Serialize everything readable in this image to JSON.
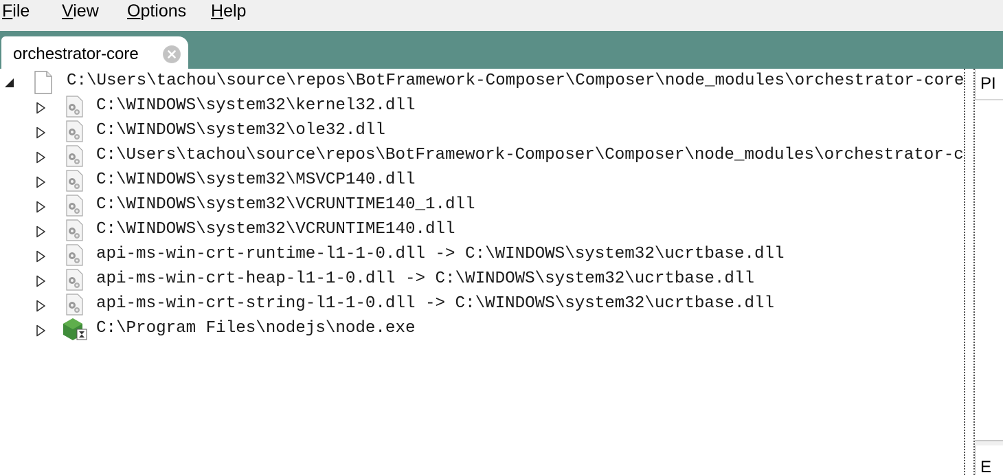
{
  "menu": {
    "items": [
      {
        "name": "file",
        "accel": "F",
        "rest": "ile"
      },
      {
        "name": "view",
        "accel": "V",
        "rest": "iew"
      },
      {
        "name": "options",
        "accel": "O",
        "rest": "ptions"
      },
      {
        "name": "help",
        "accel": "H",
        "rest": "elp"
      }
    ]
  },
  "tab": {
    "label": "orchestrator-core",
    "close_icon": "close-circle-icon"
  },
  "tree": {
    "root": {
      "icon": "file-icon",
      "expander": "expanded-triangle-icon",
      "text": "C:\\Users\\tachou\\source\\repos\\BotFramework-Composer\\Composer\\node_modules\\orchestrator-core\\orchestrator.node"
    },
    "children": [
      {
        "icon": "dll-gear-icon",
        "text": "C:\\WINDOWS\\system32\\kernel32.dll"
      },
      {
        "icon": "dll-gear-icon",
        "text": "C:\\WINDOWS\\system32\\ole32.dll"
      },
      {
        "icon": "dll-gear-icon",
        "text": "C:\\Users\\tachou\\source\\repos\\BotFramework-Composer\\Composer\\node_modules\\orchestrator-core\\orchestrator.dll"
      },
      {
        "icon": "dll-gear-icon",
        "text": "C:\\WINDOWS\\system32\\MSVCP140.dll"
      },
      {
        "icon": "dll-gear-icon",
        "text": "C:\\WINDOWS\\system32\\VCRUNTIME140_1.dll"
      },
      {
        "icon": "dll-gear-icon",
        "text": "C:\\WINDOWS\\system32\\VCRUNTIME140.dll"
      },
      {
        "icon": "dll-gear-icon",
        "text": "api-ms-win-crt-runtime-l1-1-0.dll -> C:\\WINDOWS\\system32\\ucrtbase.dll"
      },
      {
        "icon": "dll-gear-icon",
        "text": "api-ms-win-crt-heap-l1-1-0.dll -> C:\\WINDOWS\\system32\\ucrtbase.dll"
      },
      {
        "icon": "dll-gear-icon",
        "text": "api-ms-win-crt-string-l1-1-0.dll -> C:\\WINDOWS\\system32\\ucrtbase.dll"
      },
      {
        "icon": "nodejs-exe-icon",
        "text": "C:\\Program Files\\nodejs\\node.exe"
      }
    ]
  },
  "right_panes": [
    {
      "header": "PI"
    },
    {
      "header": "E"
    }
  ],
  "colors": {
    "tabstrip": "#5b8f87",
    "menubar": "#f0f0f0",
    "node_green": "#3f8c3a"
  }
}
